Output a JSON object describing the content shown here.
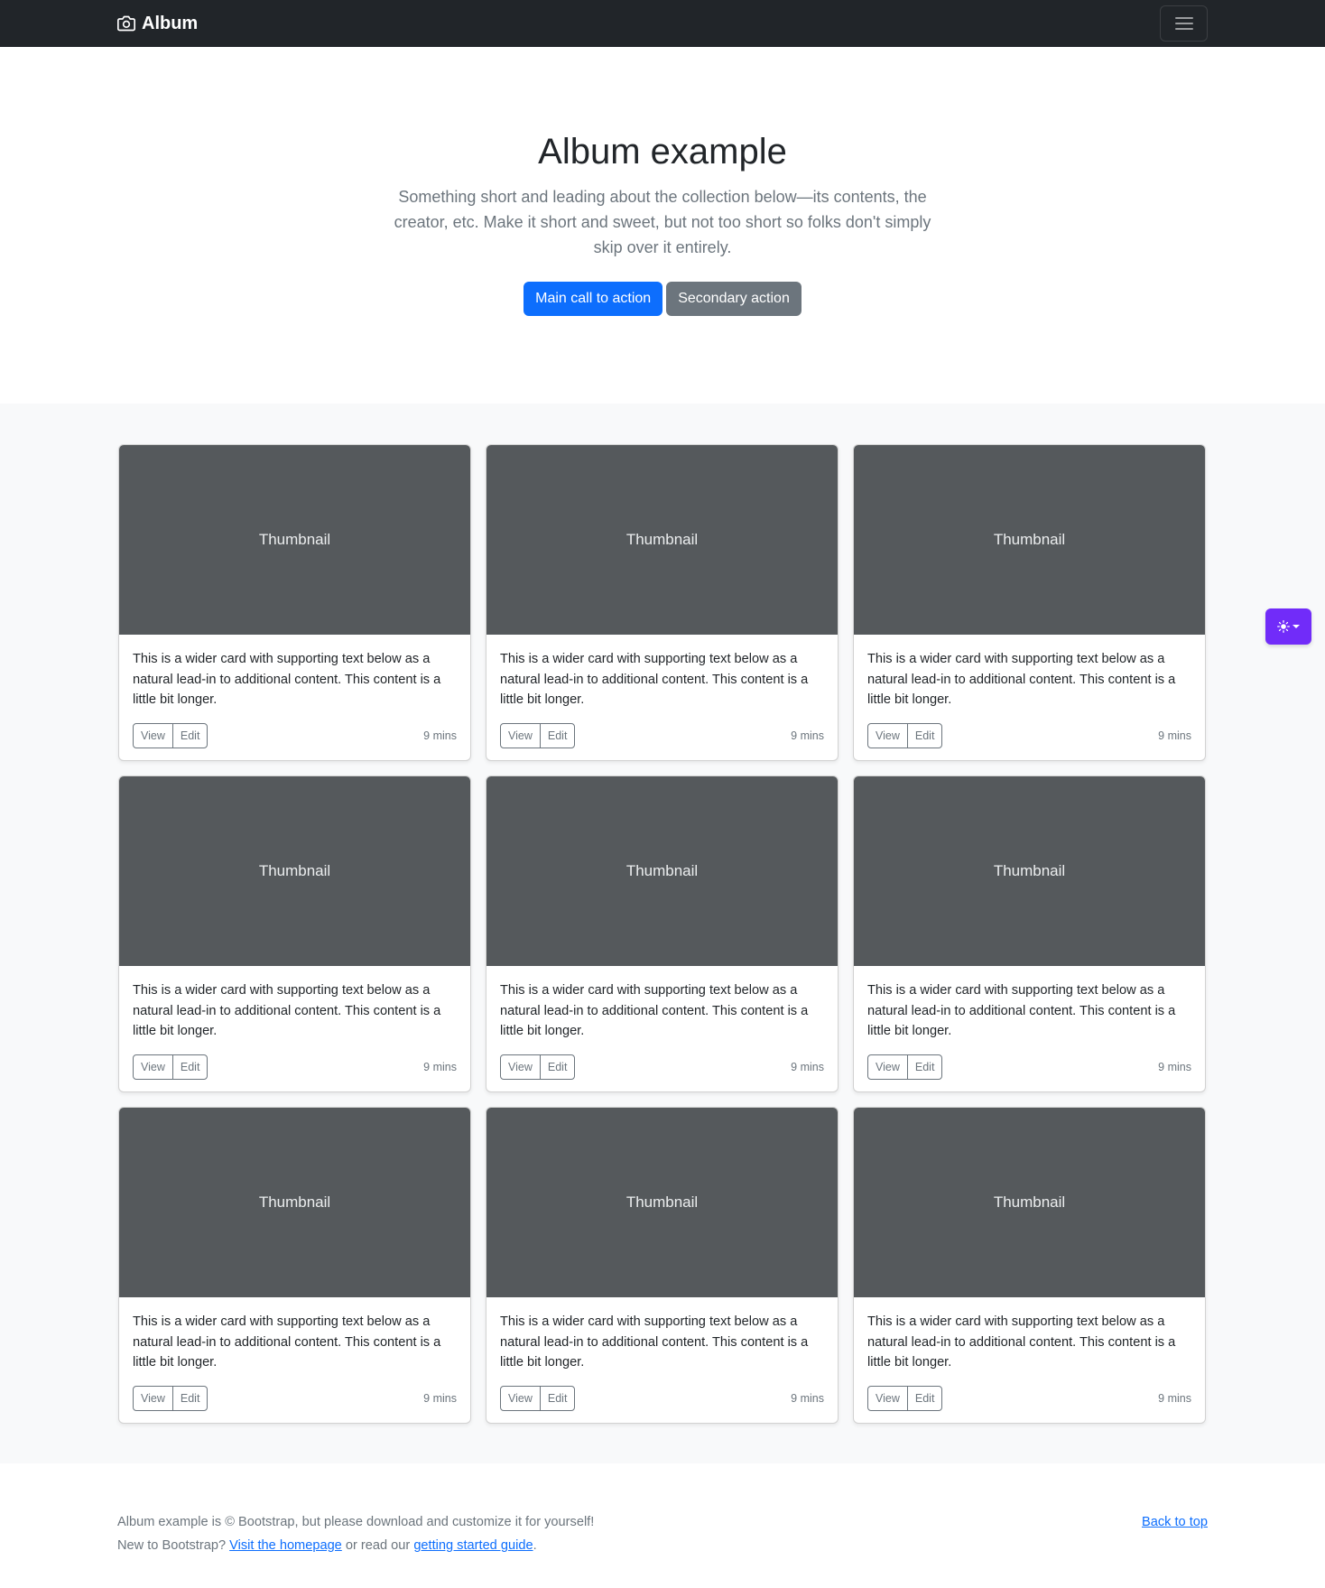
{
  "navbar": {
    "brand": "Album",
    "brand_icon": "camera-icon",
    "toggler_icon": "hamburger-icon",
    "background": "#212529"
  },
  "hero": {
    "title": "Album example",
    "lead": "Something short and leading about the collection below—its contents, the creator, etc. Make it short and sweet, but not too short so folks don't simply skip over it entirely.",
    "primary_action": "Main call to action",
    "secondary_action": "Secondary action"
  },
  "cards": [
    {
      "thumbnail": "Thumbnail",
      "text": "This is a wider card with supporting text below as a natural lead-in to additional content. This content is a little bit longer.",
      "view": "View",
      "edit": "Edit",
      "time": "9 mins"
    },
    {
      "thumbnail": "Thumbnail",
      "text": "This is a wider card with supporting text below as a natural lead-in to additional content. This content is a little bit longer.",
      "view": "View",
      "edit": "Edit",
      "time": "9 mins"
    },
    {
      "thumbnail": "Thumbnail",
      "text": "This is a wider card with supporting text below as a natural lead-in to additional content. This content is a little bit longer.",
      "view": "View",
      "edit": "Edit",
      "time": "9 mins"
    },
    {
      "thumbnail": "Thumbnail",
      "text": "This is a wider card with supporting text below as a natural lead-in to additional content. This content is a little bit longer.",
      "view": "View",
      "edit": "Edit",
      "time": "9 mins"
    },
    {
      "thumbnail": "Thumbnail",
      "text": "This is a wider card with supporting text below as a natural lead-in to additional content. This content is a little bit longer.",
      "view": "View",
      "edit": "Edit",
      "time": "9 mins"
    },
    {
      "thumbnail": "Thumbnail",
      "text": "This is a wider card with supporting text below as a natural lead-in to additional content. This content is a little bit longer.",
      "view": "View",
      "edit": "Edit",
      "time": "9 mins"
    },
    {
      "thumbnail": "Thumbnail",
      "text": "This is a wider card with supporting text below as a natural lead-in to additional content. This content is a little bit longer.",
      "view": "View",
      "edit": "Edit",
      "time": "9 mins"
    },
    {
      "thumbnail": "Thumbnail",
      "text": "This is a wider card with supporting text below as a natural lead-in to additional content. This content is a little bit longer.",
      "view": "View",
      "edit": "Edit",
      "time": "9 mins"
    },
    {
      "thumbnail": "Thumbnail",
      "text": "This is a wider card with supporting text below as a natural lead-in to additional content. This content is a little bit longer.",
      "view": "View",
      "edit": "Edit",
      "time": "9 mins"
    }
  ],
  "footer": {
    "line1": "Album example is © Bootstrap, but please download and customize it for yourself!",
    "line2_prefix": "New to Bootstrap? ",
    "homepage_link": "Visit the homepage",
    "line2_middle": " or read our ",
    "guide_link": "getting started guide",
    "line2_suffix": ".",
    "back_to_top": "Back to top"
  },
  "theme_toggle": {
    "icon": "sun-icon",
    "caret_icon": "caret-down-icon",
    "color": "#712cf9"
  },
  "colors": {
    "primary": "#0d6efd",
    "secondary": "#6c757d",
    "thumbnail_bg": "#55595c",
    "album_bg": "#f8f9fa"
  }
}
